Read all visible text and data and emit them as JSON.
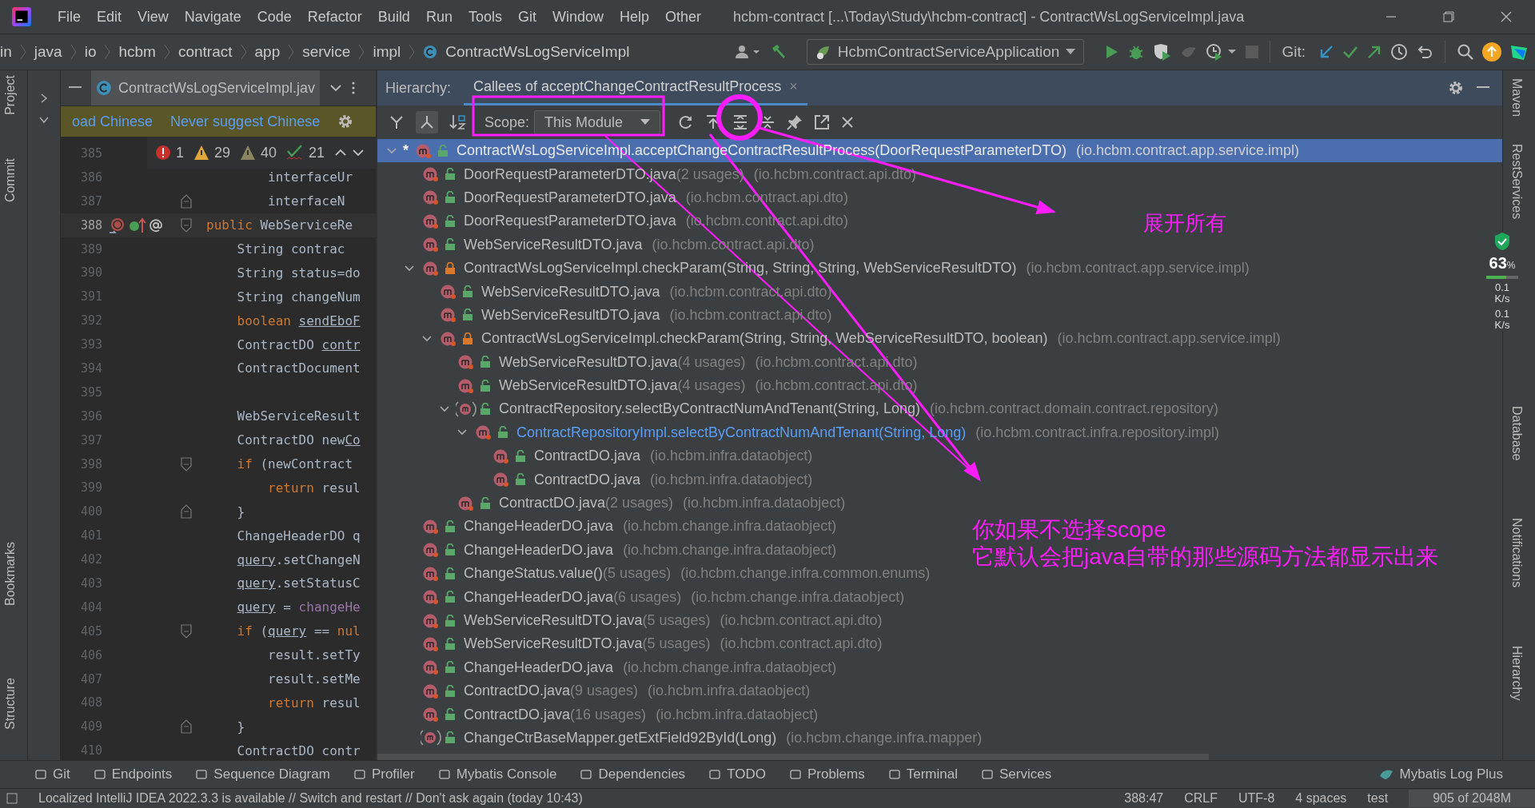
{
  "menu": [
    "File",
    "Edit",
    "View",
    "Navigate",
    "Code",
    "Refactor",
    "Build",
    "Run",
    "Tools",
    "Git",
    "Window",
    "Help",
    "Other"
  ],
  "window_title": "hcbm-contract [...\\Today\\Study\\hcbm-contract] - ContractWsLogServiceImpl.java",
  "breadcrumbs": [
    "in",
    "java",
    "io",
    "hcbm",
    "contract",
    "app",
    "service",
    "impl",
    "ContractWsLogServiceImpl"
  ],
  "run_config": "HcbmContractServiceApplication",
  "git_label": "Git:",
  "left_tools": [
    "Project",
    "Commit",
    "Bookmarks",
    "Structure"
  ],
  "right_tools": [
    "Maven",
    "RestServices",
    "Database",
    "Notifications",
    "Hierarchy"
  ],
  "editor": {
    "tab": "ContractWsLogServiceImpl.jav",
    "notification": {
      "text": "oad Chinese",
      "link": "Never suggest Chinese"
    },
    "inspections": {
      "errors": "1",
      "warnings": "29",
      "weak_warnings": "40",
      "typos": "21"
    },
    "lines": [
      {
        "num": "385"
      },
      {
        "num": "386",
        "segments": [
          {
            "kind": "plain",
            "text": "        interfaceUr"
          }
        ]
      },
      {
        "num": "387",
        "block_end": true,
        "segments": [
          {
            "kind": "plain",
            "text": "        interfaceN"
          }
        ]
      },
      {
        "num": "388",
        "current": true,
        "gutter": true,
        "block_start": true,
        "segments": [
          {
            "kind": "keyword",
            "text": "public "
          },
          {
            "kind": "plain",
            "text": "WebServiceRe"
          }
        ]
      },
      {
        "num": "389",
        "segments": [
          {
            "kind": "plain",
            "text": "    String contrac"
          }
        ]
      },
      {
        "num": "390",
        "segments": [
          {
            "kind": "plain",
            "text": "    String status=do"
          }
        ]
      },
      {
        "num": "391",
        "segments": [
          {
            "kind": "plain",
            "text": "    String changeNum"
          }
        ]
      },
      {
        "num": "392",
        "segments": [
          {
            "kind": "keyword",
            "text": "    boolean "
          },
          {
            "kind": "underlined",
            "text": "sendEboF"
          }
        ]
      },
      {
        "num": "393",
        "segments": [
          {
            "kind": "plain",
            "text": "    ContractDO "
          },
          {
            "kind": "underlined",
            "text": "contr"
          }
        ]
      },
      {
        "num": "394",
        "segments": [
          {
            "kind": "plain",
            "text": "    ContractDocument"
          }
        ]
      },
      {
        "num": "395"
      },
      {
        "num": "396",
        "segments": [
          {
            "kind": "plain",
            "text": "    WebServiceResult"
          }
        ]
      },
      {
        "num": "397",
        "segments": [
          {
            "kind": "plain",
            "text": "    ContractDO new"
          },
          {
            "kind": "underlined",
            "text": "Co"
          }
        ]
      },
      {
        "num": "398",
        "block_start": true,
        "segments": [
          {
            "kind": "keyword",
            "text": "    if "
          },
          {
            "kind": "plain",
            "text": "(newContract"
          }
        ]
      },
      {
        "num": "399",
        "segments": [
          {
            "kind": "keyword",
            "text": "        return "
          },
          {
            "kind": "plain",
            "text": "resul"
          }
        ]
      },
      {
        "num": "400",
        "block_end": true,
        "segments": [
          {
            "kind": "plain",
            "text": "    }"
          }
        ]
      },
      {
        "num": "401",
        "segments": [
          {
            "kind": "plain",
            "text": "    ChangeHeaderDO q"
          }
        ]
      },
      {
        "num": "402",
        "segments": [
          {
            "kind": "underlined",
            "text": "    query"
          },
          {
            "kind": "plain",
            "text": ".setChangeN"
          }
        ]
      },
      {
        "num": "403",
        "segments": [
          {
            "kind": "underlined",
            "text": "    query"
          },
          {
            "kind": "plain",
            "text": ".setStatusC"
          }
        ]
      },
      {
        "num": "404",
        "segments": [
          {
            "kind": "underlined",
            "text": "    query"
          },
          {
            "kind": "plain",
            "text": " = "
          },
          {
            "kind": "field",
            "text": "changeHe"
          }
        ]
      },
      {
        "num": "405",
        "block_start": true,
        "segments": [
          {
            "kind": "keyword",
            "text": "    if "
          },
          {
            "kind": "plain",
            "text": "("
          },
          {
            "kind": "underlined",
            "text": "query"
          },
          {
            "kind": "plain",
            "text": " == "
          },
          {
            "kind": "keyword",
            "text": "nul"
          }
        ]
      },
      {
        "num": "406",
        "segments": [
          {
            "kind": "plain",
            "text": "        result.setTy"
          }
        ]
      },
      {
        "num": "407",
        "segments": [
          {
            "kind": "plain",
            "text": "        result.setMe"
          }
        ]
      },
      {
        "num": "408",
        "segments": [
          {
            "kind": "keyword",
            "text": "        return "
          },
          {
            "kind": "plain",
            "text": "resul"
          }
        ]
      },
      {
        "num": "409",
        "block_end": true,
        "segments": [
          {
            "kind": "plain",
            "text": "    }"
          }
        ]
      },
      {
        "num": "410",
        "segments": [
          {
            "kind": "plain",
            "text": "    ContractDO contr"
          }
        ]
      }
    ]
  },
  "hierarchy": {
    "label": "Hierarchy:",
    "tab": "Callees of acceptChangeContractResultProcess",
    "close": "×",
    "scope": {
      "label": "Scope:",
      "value": "This Module"
    },
    "tree": [
      {
        "marker": "*",
        "name": "ContractWsLogServiceImpl.acceptChangeContractResultProcess(DoorRequestParameterDTO)",
        "package": "(io.hcbm.contract.app.service.impl)",
        "kind": "method",
        "locked": false,
        "selected": true,
        "expanded": true,
        "children": [
          {
            "name": "DoorRequestParameterDTO.java",
            "usages": "(2 usages)",
            "package": "(io.hcbm.contract.api.dto)",
            "kind": "method",
            "locked": false,
            "selected": false
          },
          {
            "name": "DoorRequestParameterDTO.java",
            "package": "(io.hcbm.contract.api.dto)",
            "kind": "method",
            "locked": false,
            "selected": false
          },
          {
            "name": "DoorRequestParameterDTO.java",
            "package": "(io.hcbm.contract.api.dto)",
            "kind": "method",
            "locked": false,
            "selected": false
          },
          {
            "name": "WebServiceResultDTO.java",
            "package": "(io.hcbm.contract.api.dto)",
            "kind": "method",
            "locked": false,
            "selected": false
          },
          {
            "name": "ContractWsLogServiceImpl.checkParam(String, String, String, WebServiceResultDTO)",
            "package": "(io.hcbm.contract.app.service.impl)",
            "kind": "method",
            "locked": true,
            "selected": false,
            "expanded": true,
            "children": [
              {
                "name": "WebServiceResultDTO.java",
                "package": "(io.hcbm.contract.api.dto)",
                "kind": "method",
                "locked": false,
                "selected": false
              },
              {
                "name": "WebServiceResultDTO.java",
                "package": "(io.hcbm.contract.api.dto)",
                "kind": "method",
                "locked": false,
                "selected": false
              },
              {
                "name": "ContractWsLogServiceImpl.checkParam(String, String, WebServiceResultDTO, boolean)",
                "package": "(io.hcbm.contract.app.service.impl)",
                "kind": "method",
                "locked": true,
                "selected": false,
                "expanded": true,
                "children": [
                  {
                    "name": "WebServiceResultDTO.java",
                    "usages": "(4 usages)",
                    "package": "(io.hcbm.contract.api.dto)",
                    "kind": "method",
                    "locked": false,
                    "selected": false
                  },
                  {
                    "name": "WebServiceResultDTO.java",
                    "usages": "(4 usages)",
                    "package": "(io.hcbm.contract.api.dto)",
                    "kind": "method",
                    "locked": false,
                    "selected": false
                  },
                  {
                    "name": "ContractRepository.selectByContractNumAndTenant(String, Long)",
                    "package": "(io.hcbm.contract.domain.contract.repository)",
                    "kind": "abstract",
                    "locked": false,
                    "selected": false,
                    "expanded": true,
                    "children": [
                      {
                        "name": "ContractRepositoryImpl.selectByContractNumAndTenant(String, Long)",
                        "package": "(io.hcbm.contract.infra.repository.impl)",
                        "kind": "method",
                        "locked": false,
                        "highlighted": true,
                        "selected": false,
                        "expanded": true,
                        "children": [
                          {
                            "name": "ContractDO.java",
                            "package": "(io.hcbm.infra.dataobject)",
                            "kind": "method",
                            "locked": false,
                            "selected": false
                          },
                          {
                            "name": "ContractDO.java",
                            "package": "(io.hcbm.infra.dataobject)",
                            "kind": "method",
                            "locked": false,
                            "selected": false
                          }
                        ]
                      }
                    ]
                  },
                  {
                    "name": "ContractDO.java",
                    "usages": "(2 usages)",
                    "package": "(io.hcbm.infra.dataobject)",
                    "kind": "method",
                    "locked": false,
                    "selected": false
                  }
                ]
              }
            ]
          },
          {
            "name": "ChangeHeaderDO.java",
            "package": "(io.hcbm.change.infra.dataobject)",
            "kind": "method",
            "locked": false,
            "selected": false
          },
          {
            "name": "ChangeHeaderDO.java",
            "package": "(io.hcbm.change.infra.dataobject)",
            "kind": "method",
            "locked": false,
            "selected": false
          },
          {
            "name": "ChangeStatus.value()",
            "usages": "(5 usages)",
            "package": "(io.hcbm.change.infra.common.enums)",
            "kind": "method",
            "locked": false,
            "selected": false
          },
          {
            "name": "ChangeHeaderDO.java",
            "usages": "(6 usages)",
            "package": "(io.hcbm.change.infra.dataobject)",
            "kind": "method",
            "locked": false,
            "selected": false
          },
          {
            "name": "WebServiceResultDTO.java",
            "usages": "(5 usages)",
            "package": "(io.hcbm.contract.api.dto)",
            "kind": "method",
            "locked": false,
            "selected": false
          },
          {
            "name": "WebServiceResultDTO.java",
            "usages": "(5 usages)",
            "package": "(io.hcbm.contract.api.dto)",
            "kind": "method",
            "locked": false,
            "selected": false
          },
          {
            "name": "ChangeHeaderDO.java",
            "package": "(io.hcbm.change.infra.dataobject)",
            "kind": "method",
            "locked": false,
            "selected": false
          },
          {
            "name": "ContractDO.java",
            "usages": "(9 usages)",
            "package": "(io.hcbm.infra.dataobject)",
            "kind": "method",
            "locked": false,
            "selected": false
          },
          {
            "name": "ContractDO.java",
            "usages": "(16 usages)",
            "package": "(io.hcbm.infra.dataobject)",
            "kind": "method",
            "locked": false,
            "selected": false
          },
          {
            "name": "ChangeCtrBaseMapper.getExtField92ById(Long)",
            "package": "(io.hcbm.change.infra.mapper)",
            "kind": "abstract",
            "locked": false,
            "selected": false
          }
        ]
      }
    ]
  },
  "bottom_tools": [
    "Git",
    "Endpoints",
    "Sequence Diagram",
    "Profiler",
    "Mybatis Console",
    "Dependencies",
    "TODO",
    "Problems",
    "Terminal",
    "Services"
  ],
  "bottom_right_tool": "Mybatis Log Plus",
  "status_bar": {
    "message": "Localized IntelliJ IDEA 2022.3.3 is available // Switch and restart // Don't ask again (today 10:43)",
    "position": "388:47",
    "line_ending": "CRLF",
    "encoding": "UTF-8",
    "indent": "4 spaces",
    "branch": "test",
    "memory": "905 of 2048M"
  },
  "net_meter": {
    "percent": "63",
    "unit": "%",
    "upload": "0.1",
    "upload_unit": "K/s",
    "download": "0.1",
    "download_unit": "K/s"
  },
  "annotations": {
    "expand_note": "展开所有",
    "scope_note": [
      "你如果不选择scope",
      "它默认会把java自带的那些源码方法都显示出来"
    ]
  }
}
